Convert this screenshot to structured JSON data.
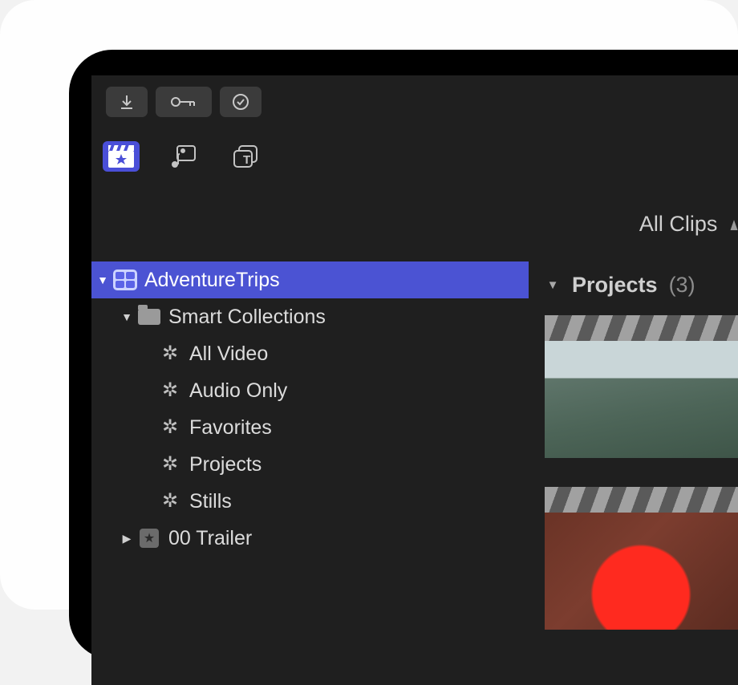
{
  "modebar": {
    "allclips_label": "All Clips"
  },
  "sidebar": {
    "library_name": "AdventureTrips",
    "smart_folder_label": "Smart Collections",
    "smart_items": [
      "All Video",
      "Audio Only",
      "Favorites",
      "Projects",
      "Stills"
    ],
    "event_name": "00 Trailer"
  },
  "browser": {
    "heading": "Projects",
    "count": "(3)"
  }
}
